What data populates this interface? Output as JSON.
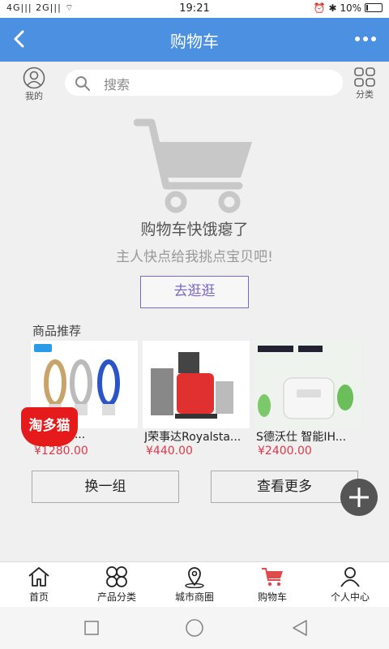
{
  "status": {
    "left": "4G|||  2G|||  ⌔",
    "time": "19:21",
    "right": "⏰ ✱ 10%"
  },
  "header": {
    "title": "购物车"
  },
  "search": {
    "mine_label": "我的",
    "placeholder": "搜索",
    "category_label": "分类"
  },
  "empty_cart": {
    "title": "购物车快饿瘪了",
    "subtitle": "主人快点给我挑点宝贝吧!",
    "go_button": "去逛逛"
  },
  "recommend": {
    "title": "商品推荐",
    "products": [
      {
        "name": "nxiang ...",
        "price": "¥1280.00",
        "icon": "bladeless-fan-image"
      },
      {
        "name": "J荣事达Royalsta...",
        "price": "¥440.00",
        "icon": "juicer-image"
      },
      {
        "name": "S德沃仕 智能IH...",
        "price": "¥2400.00",
        "icon": "rice-cooker-image"
      }
    ],
    "badge": "淘多猫",
    "swap_button": "换一组",
    "more_button": "查看更多"
  },
  "tabs": [
    {
      "label": "首页",
      "icon": "home-icon"
    },
    {
      "label": "产品分类",
      "icon": "category-icon"
    },
    {
      "label": "城市商圈",
      "icon": "map-pin-icon"
    },
    {
      "label": "购物车",
      "icon": "cart-icon",
      "active": true
    },
    {
      "label": "个人中心",
      "icon": "person-icon"
    }
  ],
  "colors": {
    "header_bg": "#4c90e2",
    "price": "#e0374a",
    "button_purple": "#7a67c8",
    "active_tab": "#e04a4a"
  }
}
